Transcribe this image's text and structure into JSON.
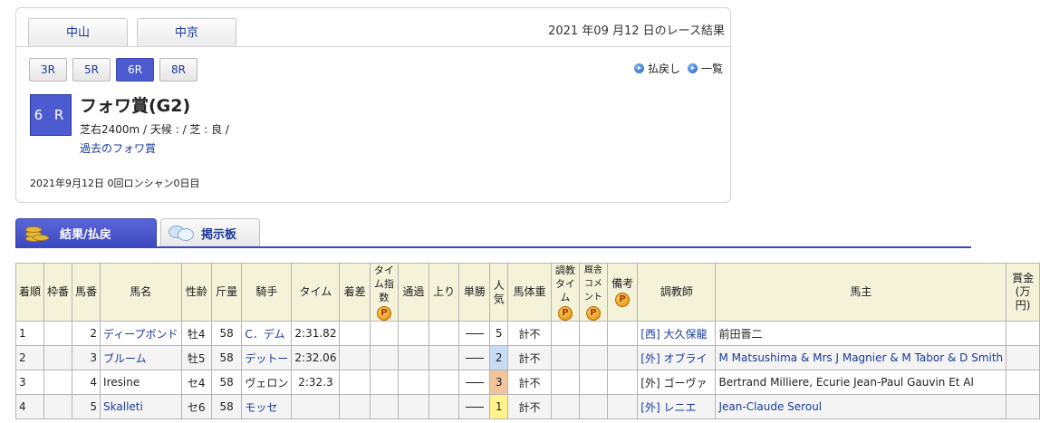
{
  "venues": [
    "中山",
    "中京"
  ],
  "result_date": "2021 年09 月12 日のレース結果",
  "rounds": [
    {
      "label": "3R",
      "active": false
    },
    {
      "label": "5R",
      "active": false
    },
    {
      "label": "6R",
      "active": true
    },
    {
      "label": "8R",
      "active": false
    }
  ],
  "nav": {
    "payout": "払戻し",
    "list": "一覧"
  },
  "race": {
    "badge": "6 R",
    "name": "フォワ賞(G2)",
    "conditions": "芝右2400m / 天候 :  / 芝 : 良 /",
    "past_link": "過去のフォワ賞",
    "meeting": "2021年9月12日  0回ロンシャン0日目"
  },
  "tabs": {
    "results": "結果/払戻",
    "board": "掲示板"
  },
  "table": {
    "headers": {
      "rank": "着順",
      "frame": "枠番",
      "horse_no": "馬番",
      "horse": "馬名",
      "sex_age": "性齢",
      "weight_carried": "斤量",
      "jockey": "騎手",
      "time": "タイム",
      "margin": "着差",
      "time_index": "タイム指数",
      "passing": "通過",
      "last3f": "上り",
      "odds": "単勝",
      "popularity": "人気",
      "body_weight": "馬体重",
      "training_time": "調教タイム",
      "stable_comment": "厩舎コメント",
      "remarks": "備考",
      "trainer": "調教師",
      "owner": "馬主",
      "prize": "賞金(万円)"
    },
    "rows": [
      {
        "rank": "1",
        "frame": "",
        "horse_no": "2",
        "horse": "ディープボンド",
        "sex_age": "牡4",
        "weight_carried": "58",
        "jockey": "C．デム",
        "time": "2:31.82",
        "margin": "",
        "time_index": "",
        "passing": "",
        "last3f": "",
        "odds": "dash",
        "popularity": "5",
        "body_weight": "計不",
        "trainer": "[西] 大久保龍",
        "owner": "前田晋二",
        "prize": ""
      },
      {
        "rank": "2",
        "frame": "",
        "horse_no": "3",
        "horse": "ブルーム",
        "sex_age": "牡5",
        "weight_carried": "58",
        "jockey": "デットー",
        "time": "2:32.06",
        "margin": "",
        "time_index": "",
        "passing": "",
        "last3f": "",
        "odds": "dash",
        "popularity": "2",
        "body_weight": "計不",
        "trainer": "[外] オブライ",
        "owner": "M Matsushima & Mrs J Magnier & M Tabor & D Smith",
        "prize": ""
      },
      {
        "rank": "3",
        "frame": "",
        "horse_no": "4",
        "horse": "Iresine",
        "sex_age": "セ4",
        "weight_carried": "58",
        "jockey": "ヴェロン",
        "time": "2:32.3",
        "margin": "",
        "time_index": "",
        "passing": "",
        "last3f": "",
        "odds": "dash",
        "popularity": "3",
        "body_weight": "計不",
        "trainer": "[外] ゴーヴァ",
        "owner": "Bertrand Milliere, Ecurie Jean-Paul Gauvin Et Al",
        "prize": ""
      },
      {
        "rank": "4",
        "frame": "",
        "horse_no": "5",
        "horse": "Skalleti",
        "sex_age": "セ6",
        "weight_carried": "58",
        "jockey": "モッセ",
        "time": "",
        "margin": "",
        "time_index": "",
        "passing": "",
        "last3f": "",
        "odds": "dash",
        "popularity": "1",
        "body_weight": "計不",
        "trainer": "[外] レニエ",
        "owner": "Jean-Claude Seroul",
        "prize": ""
      }
    ]
  },
  "colors": {
    "accent": "#4d5bd0",
    "header_bg": "#f4f2d9",
    "pop_1": "#fff28a",
    "pop_2": "#c9dcf6",
    "pop_3": "#f2c49c"
  }
}
